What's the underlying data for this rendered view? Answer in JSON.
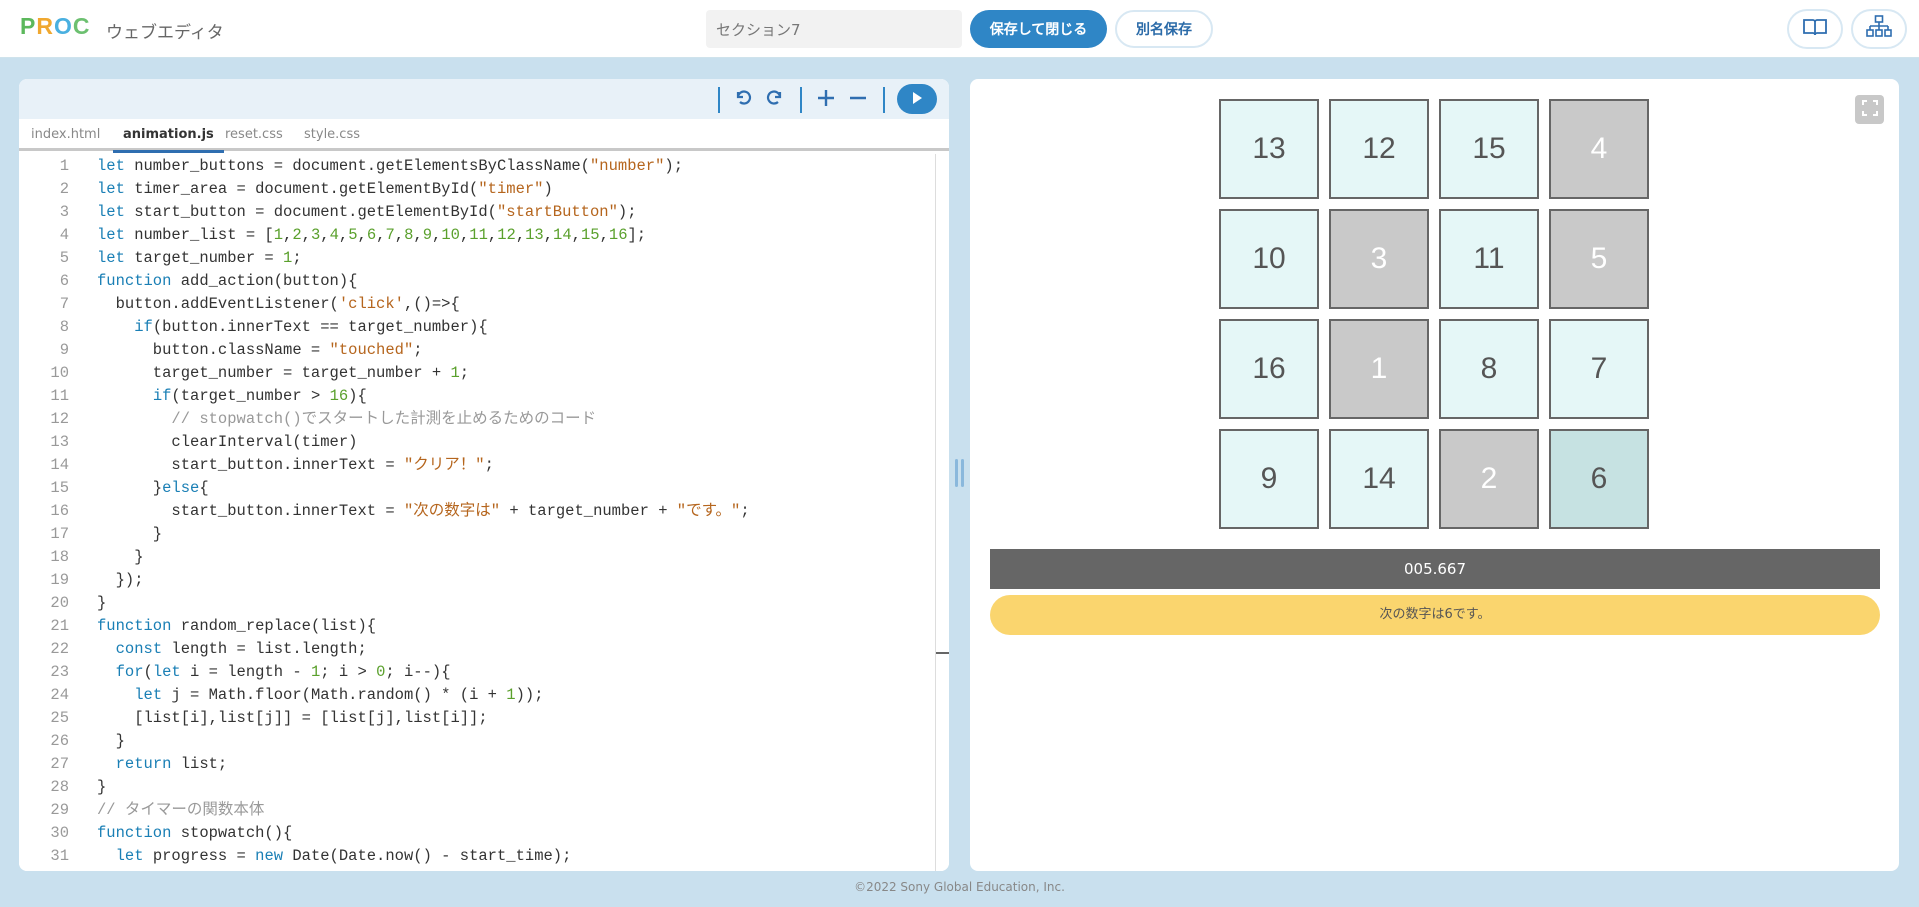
{
  "header": {
    "logo": {
      "p": "P",
      "r": "R",
      "o": "O",
      "c": "C"
    },
    "app_title": "ウェブエディタ",
    "section_name": "セクション7",
    "save_close_label": "保存して閉じる",
    "save_as_label": "別名保存",
    "book_icon": "book-icon",
    "sitemap_icon": "sitemap-icon"
  },
  "editor": {
    "toolbar": {
      "undo_icon": "undo-icon",
      "redo_icon": "redo-icon",
      "zoom_in_icon": "plus-icon",
      "zoom_out_icon": "minus-icon",
      "run_icon": "play-icon"
    },
    "tabs": [
      {
        "label": "index.html",
        "active": false
      },
      {
        "label": "animation.js",
        "active": true
      },
      {
        "label": "reset.css",
        "active": false
      },
      {
        "label": "style.css",
        "active": false
      }
    ],
    "lines": [
      {
        "n": "1",
        "html": "<span class='kw'>let</span> number_buttons = document.getElementsByClassName(<span class='str'>\"number\"</span>);"
      },
      {
        "n": "2",
        "html": "<span class='kw'>let</span> timer_area = document.getElementById(<span class='str'>\"timer\"</span>)"
      },
      {
        "n": "3",
        "html": "<span class='kw'>let</span> start_button = document.getElementById(<span class='str'>\"startButton\"</span>);"
      },
      {
        "n": "4",
        "html": "<span class='kw'>let</span> number_list = [<span class='num'>1</span>,<span class='num'>2</span>,<span class='num'>3</span>,<span class='num'>4</span>,<span class='num'>5</span>,<span class='num'>6</span>,<span class='num'>7</span>,<span class='num'>8</span>,<span class='num'>9</span>,<span class='num'>10</span>,<span class='num'>11</span>,<span class='num'>12</span>,<span class='num'>13</span>,<span class='num'>14</span>,<span class='num'>15</span>,<span class='num'>16</span>];"
      },
      {
        "n": "5",
        "html": "<span class='kw'>let</span> target_number = <span class='num'>1</span>;"
      },
      {
        "n": "6",
        "html": "<span class='kw'>function</span> add_action(button){"
      },
      {
        "n": "7",
        "html": "  button.addEventListener(<span class='str'>'click'</span>,()=>{"
      },
      {
        "n": "8",
        "html": "    <span class='kw'>if</span>(button.innerText == target_number){"
      },
      {
        "n": "9",
        "html": "      button.className = <span class='str'>\"touched\"</span>;"
      },
      {
        "n": "10",
        "html": "      target_number = target_number + <span class='num'>1</span>;"
      },
      {
        "n": "11",
        "html": "      <span class='kw'>if</span>(target_number > <span class='num'>16</span>){"
      },
      {
        "n": "12",
        "html": "        <span class='cm'>// stopwatch()でスタートした計測を止めるためのコード</span>"
      },
      {
        "n": "13",
        "html": "        clearInterval(timer)"
      },
      {
        "n": "14",
        "html": "        start_button.innerText = <span class='str'>\"クリア！\"</span>;"
      },
      {
        "n": "15",
        "html": "      }<span class='kw'>else</span>{"
      },
      {
        "n": "16",
        "html": "        start_button.innerText = <span class='str'>\"次の数字は\"</span> + target_number + <span class='str'>\"です。\"</span>;"
      },
      {
        "n": "17",
        "html": "      }"
      },
      {
        "n": "18",
        "html": "    }"
      },
      {
        "n": "19",
        "html": "  });"
      },
      {
        "n": "20",
        "html": "}"
      },
      {
        "n": "21",
        "html": "<span class='kw'>function</span> random_replace(list){"
      },
      {
        "n": "22",
        "html": "  <span class='kw'>const</span> length = list.length;"
      },
      {
        "n": "23",
        "html": "  <span class='kw'>for</span>(<span class='kw'>let</span> i = length - <span class='num'>1</span>; i > <span class='num'>0</span>; i--){"
      },
      {
        "n": "24",
        "html": "    <span class='kw'>let</span> j = Math.floor(Math.random() * (i + <span class='num'>1</span>));"
      },
      {
        "n": "25",
        "html": "    [list[i],list[j]] = [list[j],list[i]];"
      },
      {
        "n": "26",
        "html": "  }"
      },
      {
        "n": "27",
        "html": "  <span class='kw'>return</span> list;"
      },
      {
        "n": "28",
        "html": "}"
      },
      {
        "n": "29",
        "html": "<span class='cm'>// タイマーの関数本体</span>"
      },
      {
        "n": "30",
        "html": "<span class='kw'>function</span> stopwatch(){"
      },
      {
        "n": "31",
        "html": "  <span class='kw'>let</span> progress = <span class='kw'>new</span> Date(Date.now() - start_time);"
      }
    ]
  },
  "preview": {
    "fullscreen_icon": "fullscreen-icon",
    "cells": [
      {
        "label": "13",
        "state": "normal"
      },
      {
        "label": "12",
        "state": "normal"
      },
      {
        "label": "15",
        "state": "normal"
      },
      {
        "label": "4",
        "state": "touched"
      },
      {
        "label": "10",
        "state": "normal"
      },
      {
        "label": "3",
        "state": "touched"
      },
      {
        "label": "11",
        "state": "normal"
      },
      {
        "label": "5",
        "state": "touched"
      },
      {
        "label": "16",
        "state": "normal"
      },
      {
        "label": "1",
        "state": "touched"
      },
      {
        "label": "8",
        "state": "normal"
      },
      {
        "label": "7",
        "state": "normal"
      },
      {
        "label": "9",
        "state": "normal"
      },
      {
        "label": "14",
        "state": "normal"
      },
      {
        "label": "2",
        "state": "touched"
      },
      {
        "label": "6",
        "state": "hover"
      }
    ],
    "timer": "005.667",
    "start_button": "次の数字は6です。"
  },
  "footer": "©2022 Sony Global Education, Inc."
}
